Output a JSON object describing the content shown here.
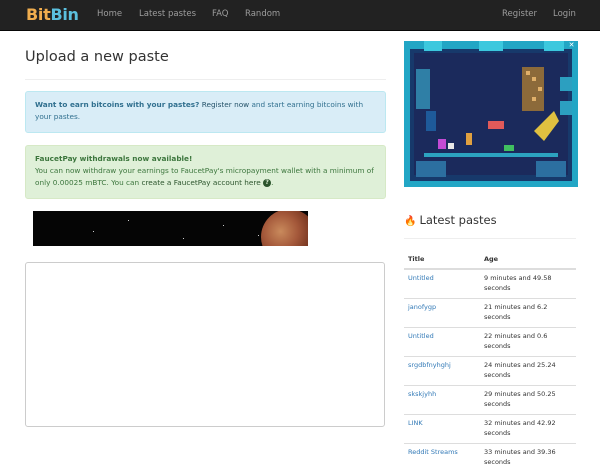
{
  "navbar": {
    "brand_part1": "Bit",
    "brand_part2": "Bin",
    "links": [
      "Home",
      "Latest pastes",
      "FAQ",
      "Random"
    ],
    "register": "Register",
    "login": "Login",
    "colors": {
      "bg": "#222222",
      "link": "#9d9d9d",
      "brand1": "#f0ad4e",
      "brand2": "#5bc0de"
    }
  },
  "main": {
    "title": "Upload a new paste",
    "info_alert": {
      "bold": "Want to earn bitcoins with your pastes?",
      "link": "Register now",
      "rest": " and start earning bitcoins with your pastes."
    },
    "success_alert": {
      "heading": "FaucetPay withdrawals now available!",
      "text": "You can now withdraw your earnings to FaucetPay's micropayment wallet with a minimum of only 0.00025 mBTC. You can ",
      "link": "create a FaucetPay account here",
      "end": "."
    },
    "paste_value": ""
  },
  "sidebar": {
    "heading": "Latest pastes",
    "columns": [
      "Title",
      "Age"
    ],
    "rows": [
      {
        "title": "Untitled",
        "age": "9 minutes and 49.58 seconds"
      },
      {
        "title": "janofygp",
        "age": "21 minutes and 6.2 seconds"
      },
      {
        "title": "Untitled",
        "age": "22 minutes and 0.6 seconds"
      },
      {
        "title": "srgdbfnyhghj",
        "age": "24 minutes and 25.24 seconds"
      },
      {
        "title": "skskjyhh",
        "age": "29 minutes and 50.25 seconds"
      },
      {
        "title": "LINK",
        "age": "32 minutes and 42.92 seconds"
      },
      {
        "title": "Reddit Streams",
        "age": "33 minutes and 39.36 seconds"
      }
    ]
  },
  "icons": {
    "flame": "fire-icon",
    "question": "question-circle-icon",
    "ad_close": "close-icon"
  }
}
